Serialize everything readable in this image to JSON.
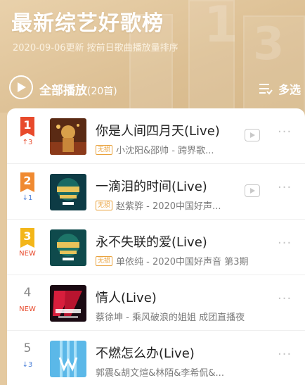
{
  "header": {
    "title": "最新综艺好歌榜",
    "subtitle": "2020-09-06更新 按前日歌曲播放量排序",
    "play_all": "全部播放",
    "play_count": "(20首)",
    "multi_select": "多选"
  },
  "songs": [
    {
      "rank": "1",
      "trend": "↑3",
      "title": "你是人间四月天(Live)",
      "badge": "无损",
      "artist": "小沈阳&邵帅 - 跨界歌...",
      "has_video": true
    },
    {
      "rank": "2",
      "trend": "↓1",
      "title": "一滴泪的时间(Live)",
      "badge": "无损",
      "artist": "赵紫骅 - 2020中国好声...",
      "has_video": true
    },
    {
      "rank": "3",
      "trend": "NEW",
      "title": "永不失联的爱(Live)",
      "badge": "无损",
      "artist": "单依纯 - 2020中国好声音 第3期",
      "has_video": false
    },
    {
      "rank": "4",
      "trend": "NEW",
      "title": "情人(Live)",
      "badge": "",
      "artist": "蔡徐坤 - 乘风破浪的姐姐 成团直播夜",
      "has_video": false
    },
    {
      "rank": "5",
      "trend": "↓3",
      "title": "不燃怎么办(Live)",
      "badge": "",
      "artist": "郭震&胡文煊&林陌&李希侃&...",
      "has_video": false
    }
  ],
  "colors": {
    "rank1": "#e84a2c",
    "rank2": "#f08a31",
    "rank3": "#f3b619",
    "up": "#e84a2c",
    "down": "#4a7fd8",
    "new": "#e84a2c",
    "badge": "#e9a13b"
  }
}
